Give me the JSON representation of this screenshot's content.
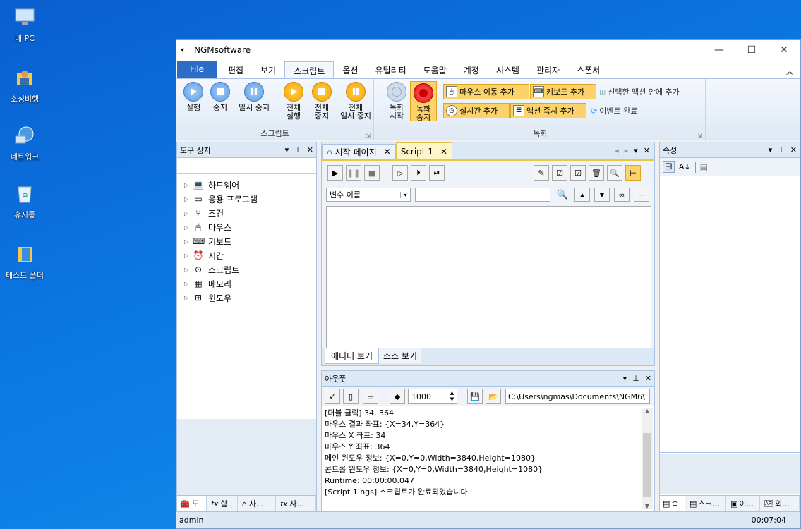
{
  "desktop": {
    "icons": [
      {
        "label": "내 PC",
        "icon": "this-pc-icon"
      },
      {
        "label": "소싱비행",
        "icon": "user-folder-icon"
      },
      {
        "label": "네트워크",
        "icon": "network-icon"
      },
      {
        "label": "휴지통",
        "icon": "recycle-bin-icon"
      },
      {
        "label": "테스트 폴더",
        "icon": "folder-icon"
      }
    ]
  },
  "window": {
    "title": "NGMsoftware",
    "controls": {
      "minimize": "—",
      "maximize": "☐",
      "close": "✕"
    }
  },
  "ribbon_tabs": [
    "File",
    "편집",
    "보기",
    "스크립트",
    "옵션",
    "유틸리티",
    "도움말",
    "계정",
    "시스템",
    "관리자",
    "스폰서"
  ],
  "ribbon": {
    "script_group": {
      "label": "스크립트",
      "buttons": [
        {
          "l1": "실행",
          "l2": ""
        },
        {
          "l1": "중지",
          "l2": ""
        },
        {
          "l1": "일시 중지",
          "l2": ""
        },
        {
          "l1": "전체",
          "l2": "실행"
        },
        {
          "l1": "전체",
          "l2": "중지"
        },
        {
          "l1": "전체",
          "l2": "일시 중지"
        }
      ]
    },
    "record_group": {
      "label": "녹화",
      "start": {
        "l1": "녹화",
        "l2": "시작"
      },
      "stop": {
        "l1": "녹화",
        "l2": "중지"
      },
      "small": [
        "마우스 이동 추가",
        "키보드 추가",
        "선택한 액션 안에 추가",
        "실시간 추가",
        "액션 즉시 추가",
        "이벤트 완료"
      ]
    }
  },
  "toolbox": {
    "title": "도구 상자",
    "items": [
      "하드웨어",
      "응용 프로그램",
      "조건",
      "마우스",
      "키보드",
      "시간",
      "스크립트",
      "메모리",
      "윈도우"
    ],
    "bottom_tabs": [
      "도",
      "함",
      "사...",
      "사..."
    ]
  },
  "editor": {
    "tabs": [
      "시작 페이지",
      "Script 1"
    ],
    "variable_select": "변수 이름",
    "search_value": "",
    "bottom_tabs": [
      "에디터 보기",
      "소스 보기"
    ]
  },
  "output": {
    "title": "아웃풋",
    "count": "1000",
    "path": "C:\\Users\\ngmas\\Documents\\NGM6\\",
    "lines": [
      "[더블 클릭] 34, 364",
      "마우스 결과 좌표: {X=34,Y=364}",
      "마우스 X 좌표: 34",
      "마우스 Y 좌표: 364",
      "메인 윈도우 정보: {X=0,Y=0,Width=3840,Height=1080}",
      "콘트롤 윈도우 정보: {X=0,Y=0,Width=3840,Height=1080}",
      "Runtime: 00:00:00.047",
      "[Script 1.ngs] 스크립트가 완료되었습니다."
    ]
  },
  "properties": {
    "title": "속성",
    "bottom_tabs": [
      "속",
      "스크...",
      "이...",
      "외..."
    ]
  },
  "status": {
    "user": "admin",
    "time": "00:07:04"
  }
}
